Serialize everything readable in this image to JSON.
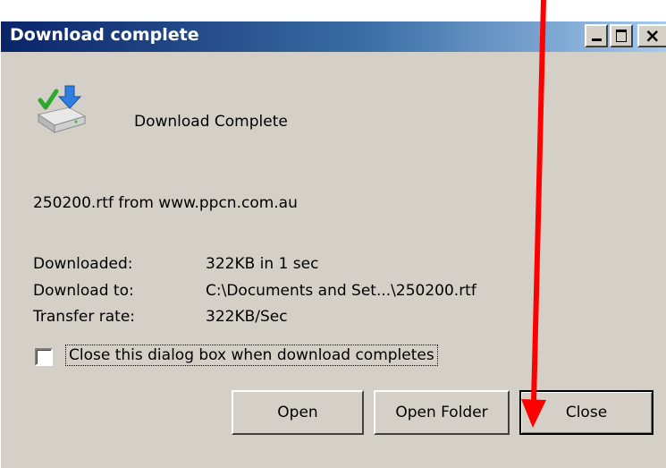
{
  "window": {
    "title": "Download complete",
    "caption_buttons": {
      "minimize_icon": "minimize-icon",
      "maximize_icon": "maximize-icon",
      "close_glyph": "×"
    }
  },
  "header": {
    "icon": "download-complete-icon",
    "text": "Download Complete"
  },
  "source": "250200.rtf from www.ppcn.com.au",
  "info": {
    "downloaded_label": "Downloaded:",
    "downloaded_value": "322KB in 1 sec",
    "download_to_label": "Download to:",
    "download_to_value": "C:\\Documents and Set...\\250200.rtf",
    "transfer_rate_label": "Transfer rate:",
    "transfer_rate_value": "322KB/Sec"
  },
  "checkbox": {
    "label": "Close this dialog box when download completes",
    "checked": false
  },
  "buttons": {
    "open": "Open",
    "open_folder": "Open Folder",
    "close": "Close"
  },
  "annotation": {
    "arrow_color": "#ff0000",
    "arrow_icon": "red-arrow-pointer"
  },
  "colors": {
    "titlebar_start": "#0a246a",
    "titlebar_end": "#a6caf0",
    "face": "#d4d0c8"
  }
}
